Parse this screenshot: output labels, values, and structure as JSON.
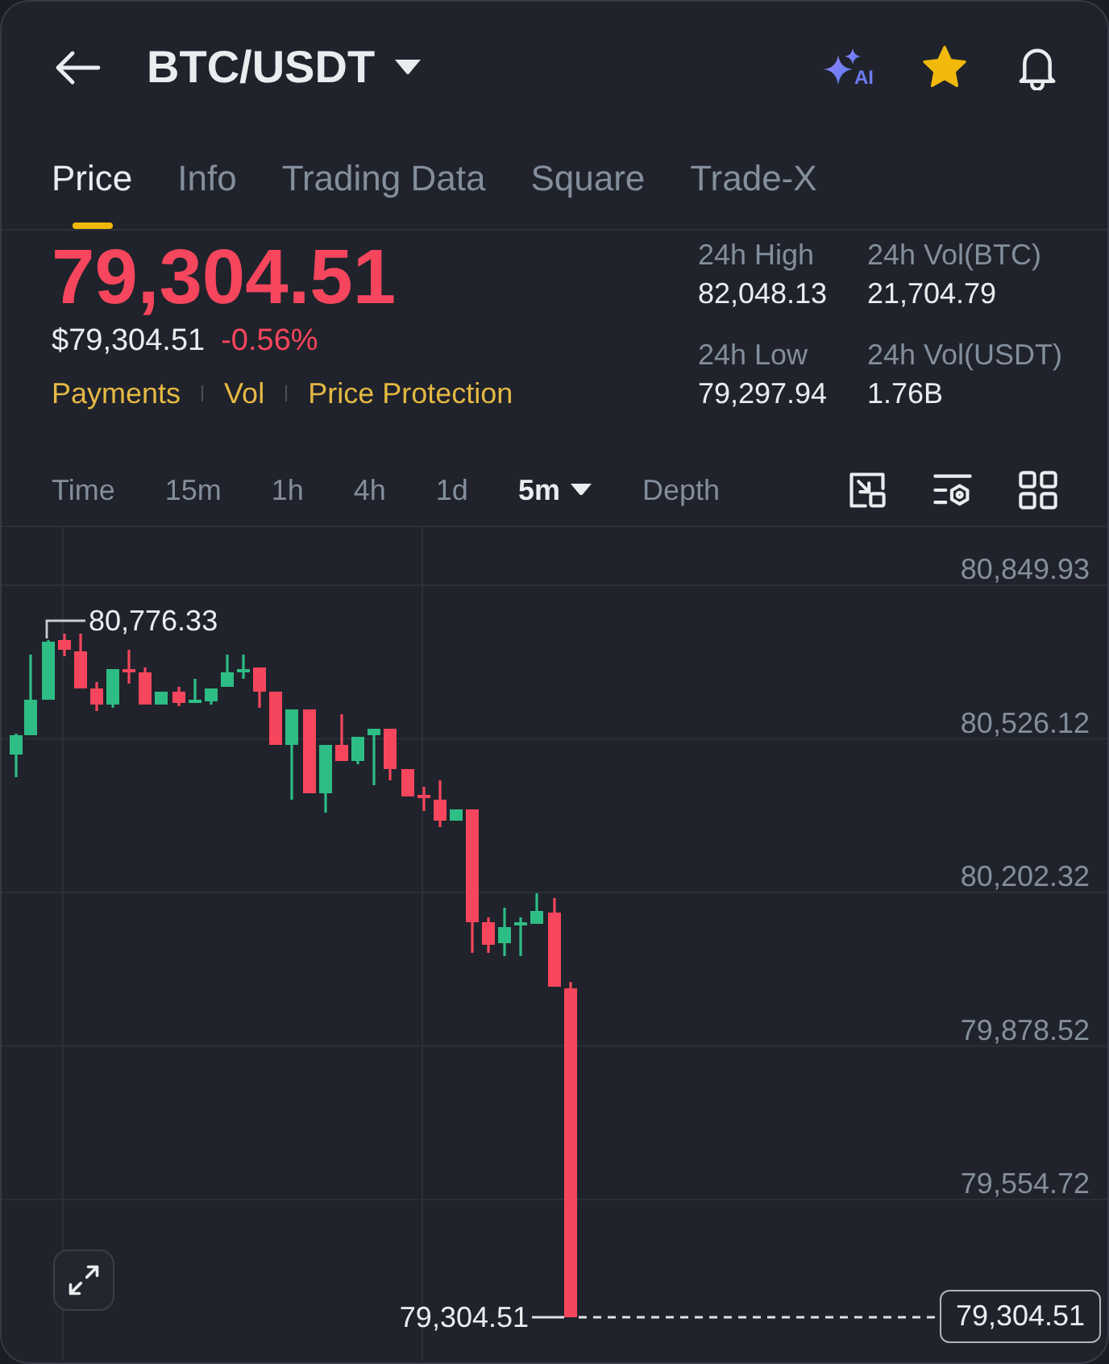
{
  "header": {
    "pair": "BTC/USDT",
    "ai_label": "AI",
    "favorite": true
  },
  "tabs": [
    {
      "label": "Price",
      "selected": true
    },
    {
      "label": "Info",
      "selected": false
    },
    {
      "label": "Trading Data",
      "selected": false
    },
    {
      "label": "Square",
      "selected": false
    },
    {
      "label": "Trade-X",
      "selected": false
    }
  ],
  "price": {
    "last": "79,304.51",
    "usd": "$79,304.51",
    "change": "-0.56%",
    "falling": true
  },
  "tags": [
    "Payments",
    "Vol",
    "Price Protection"
  ],
  "stats": [
    {
      "label": "24h High",
      "value": "82,048.13"
    },
    {
      "label": "24h Vol(BTC)",
      "value": "21,704.79"
    },
    {
      "label": "24h Low",
      "value": "79,297.94"
    },
    {
      "label": "24h Vol(USDT)",
      "value": "1.76B"
    }
  ],
  "intervals": [
    {
      "label": "Time",
      "kind": "plain",
      "selected": false
    },
    {
      "label": "15m",
      "kind": "plain",
      "selected": false
    },
    {
      "label": "1h",
      "kind": "plain",
      "selected": false
    },
    {
      "label": "4h",
      "kind": "plain",
      "selected": false
    },
    {
      "label": "1d",
      "kind": "plain",
      "selected": false
    },
    {
      "label": "5m",
      "kind": "menu",
      "selected": true
    },
    {
      "label": "Depth",
      "kind": "plain",
      "selected": false
    }
  ],
  "chart": {
    "axis_labels": [
      "80,849.93",
      "80,526.12",
      "80,202.32",
      "79,878.52",
      "79,554.72"
    ],
    "high_label": "80,776.33",
    "last_label": "79,304.51",
    "price_tag": "79,304.51"
  }
}
